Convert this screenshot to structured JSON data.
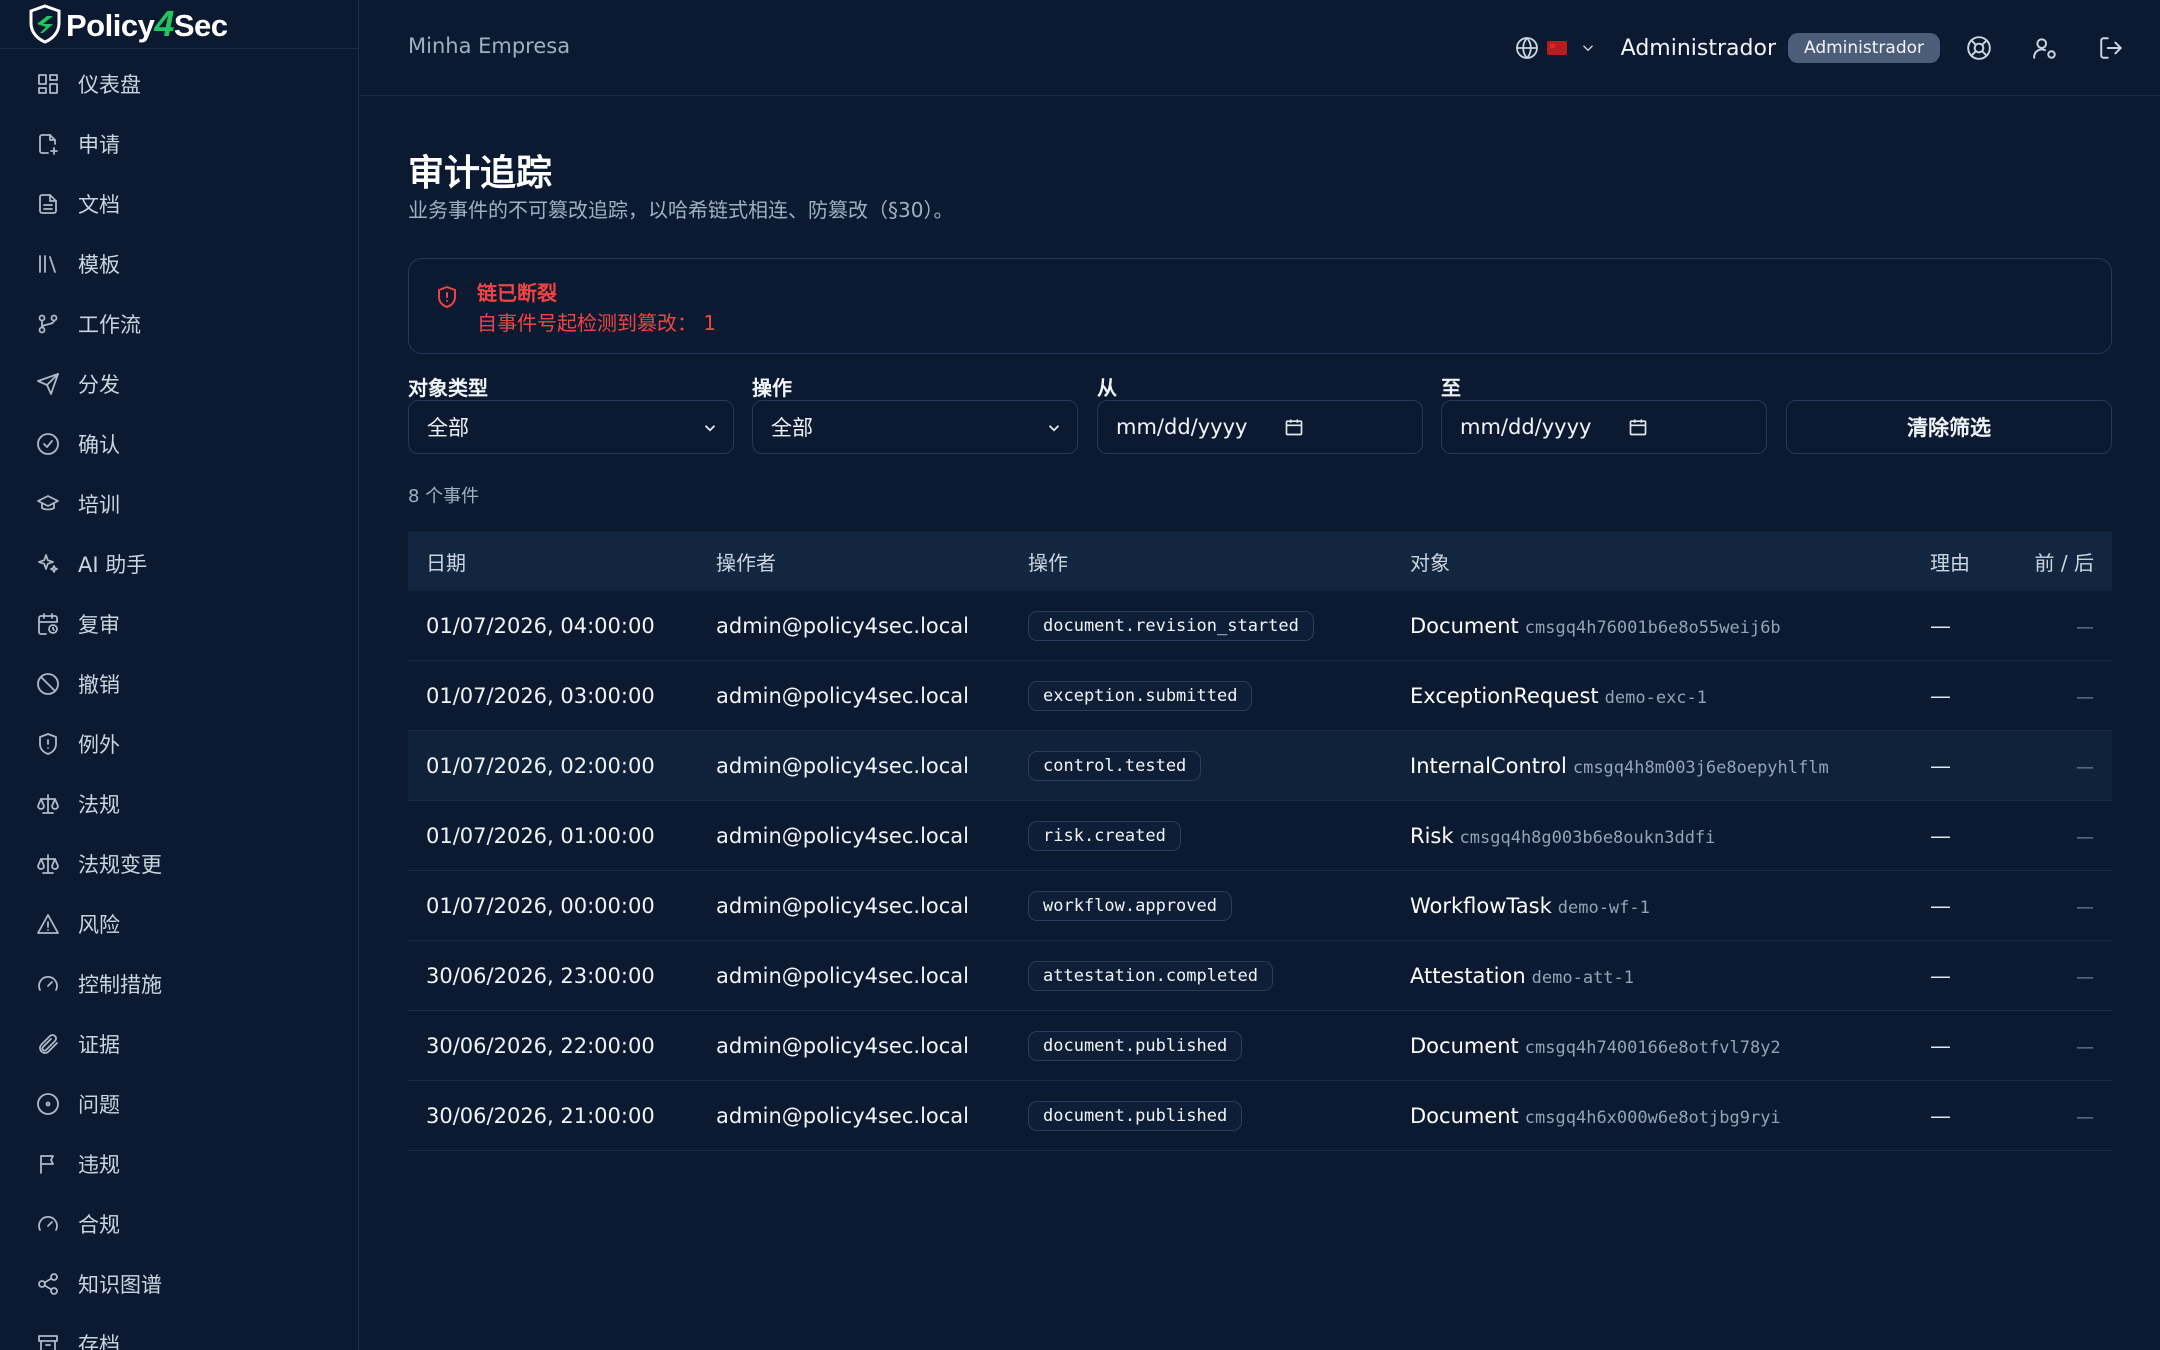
{
  "brand": {
    "name_a": "Policy",
    "name_b": "4",
    "name_c": "Sec"
  },
  "sidebar": {
    "items": [
      {
        "label": "仪表盘",
        "icon": "dashboard-icon"
      },
      {
        "label": "申请",
        "icon": "file-request-icon"
      },
      {
        "label": "文档",
        "icon": "document-icon"
      },
      {
        "label": "模板",
        "icon": "library-icon"
      },
      {
        "label": "工作流",
        "icon": "workflow-icon"
      },
      {
        "label": "分发",
        "icon": "send-icon"
      },
      {
        "label": "确认",
        "icon": "check-circle-icon"
      },
      {
        "label": "培训",
        "icon": "graduation-cap-icon"
      },
      {
        "label": "AI 助手",
        "icon": "sparkles-icon"
      },
      {
        "label": "复审",
        "icon": "calendar-clock-icon"
      },
      {
        "label": "撤销",
        "icon": "ban-icon"
      },
      {
        "label": "例外",
        "icon": "shield-alert-icon"
      },
      {
        "label": "法规",
        "icon": "scale-icon"
      },
      {
        "label": "法规变更",
        "icon": "scale-icon"
      },
      {
        "label": "风险",
        "icon": "warning-triangle-icon"
      },
      {
        "label": "控制措施",
        "icon": "gauge-icon"
      },
      {
        "label": "证据",
        "icon": "paperclip-icon"
      },
      {
        "label": "问题",
        "icon": "circle-dot-icon"
      },
      {
        "label": "违规",
        "icon": "flag-icon"
      },
      {
        "label": "合规",
        "icon": "gauge-icon"
      },
      {
        "label": "知识图谱",
        "icon": "share-graph-icon"
      },
      {
        "label": "存档",
        "icon": "archive-icon"
      }
    ]
  },
  "topbar": {
    "org": "Minha Empresa",
    "user": "Administrador",
    "role": "Administrador"
  },
  "page": {
    "title": "审计追踪",
    "subtitle": "业务事件的不可篡改追踪，以哈希链式相连、防篡改（§30）。"
  },
  "alert": {
    "title": "链已断裂",
    "message": "自事件号起检测到篡改： 1",
    "color": "#ef4444"
  },
  "filters": {
    "object_type": {
      "label": "对象类型",
      "value": "全部"
    },
    "operation": {
      "label": "操作",
      "value": "全部"
    },
    "from": {
      "label": "从",
      "value": "mm/dd/yyyy"
    },
    "to": {
      "label": "至",
      "value": "mm/dd/yyyy"
    },
    "clear_label": "清除筛选"
  },
  "count_text": "8 个事件",
  "table": {
    "headers": {
      "date": "日期",
      "actor": "操作者",
      "operation": "操作",
      "object": "对象",
      "reason": "理由",
      "before_after": "前 / 后"
    },
    "rows": [
      {
        "date": "01/07/2026, 04:00:00",
        "actor": "admin@policy4sec.local",
        "operation": "document.revision_started",
        "obj_type": "Document",
        "obj_id": "cmsgq4h76001b6e8o55weij6b",
        "reason": "—",
        "before_after": "—"
      },
      {
        "date": "01/07/2026, 03:00:00",
        "actor": "admin@policy4sec.local",
        "operation": "exception.submitted",
        "obj_type": "ExceptionRequest",
        "obj_id": "demo-exc-1",
        "reason": "—",
        "before_after": "—"
      },
      {
        "date": "01/07/2026, 02:00:00",
        "actor": "admin@policy4sec.local",
        "operation": "control.tested",
        "obj_type": "InternalControl",
        "obj_id": "cmsgq4h8m003j6e8oepyhlflm",
        "reason": "—",
        "before_after": "—"
      },
      {
        "date": "01/07/2026, 01:00:00",
        "actor": "admin@policy4sec.local",
        "operation": "risk.created",
        "obj_type": "Risk",
        "obj_id": "cmsgq4h8g003b6e8oukn3ddfi",
        "reason": "—",
        "before_after": "—"
      },
      {
        "date": "01/07/2026, 00:00:00",
        "actor": "admin@policy4sec.local",
        "operation": "workflow.approved",
        "obj_type": "WorkflowTask",
        "obj_id": "demo-wf-1",
        "reason": "—",
        "before_after": "—"
      },
      {
        "date": "30/06/2026, 23:00:00",
        "actor": "admin@policy4sec.local",
        "operation": "attestation.completed",
        "obj_type": "Attestation",
        "obj_id": "demo-att-1",
        "reason": "—",
        "before_after": "—"
      },
      {
        "date": "30/06/2026, 22:00:00",
        "actor": "admin@policy4sec.local",
        "operation": "document.published",
        "obj_type": "Document",
        "obj_id": "cmsgq4h7400166e8otfvl78y2",
        "reason": "—",
        "before_after": "—"
      },
      {
        "date": "30/06/2026, 21:00:00",
        "actor": "admin@policy4sec.local",
        "operation": "document.published",
        "obj_type": "Document",
        "obj_id": "cmsgq4h6x000w6e8otjbg9ryi",
        "reason": "—",
        "before_after": "—"
      }
    ]
  },
  "colors": {
    "background": "#0b1a30",
    "brand_green": "#22c55e",
    "danger": "#ef4444",
    "badge": "#4b5d79"
  }
}
